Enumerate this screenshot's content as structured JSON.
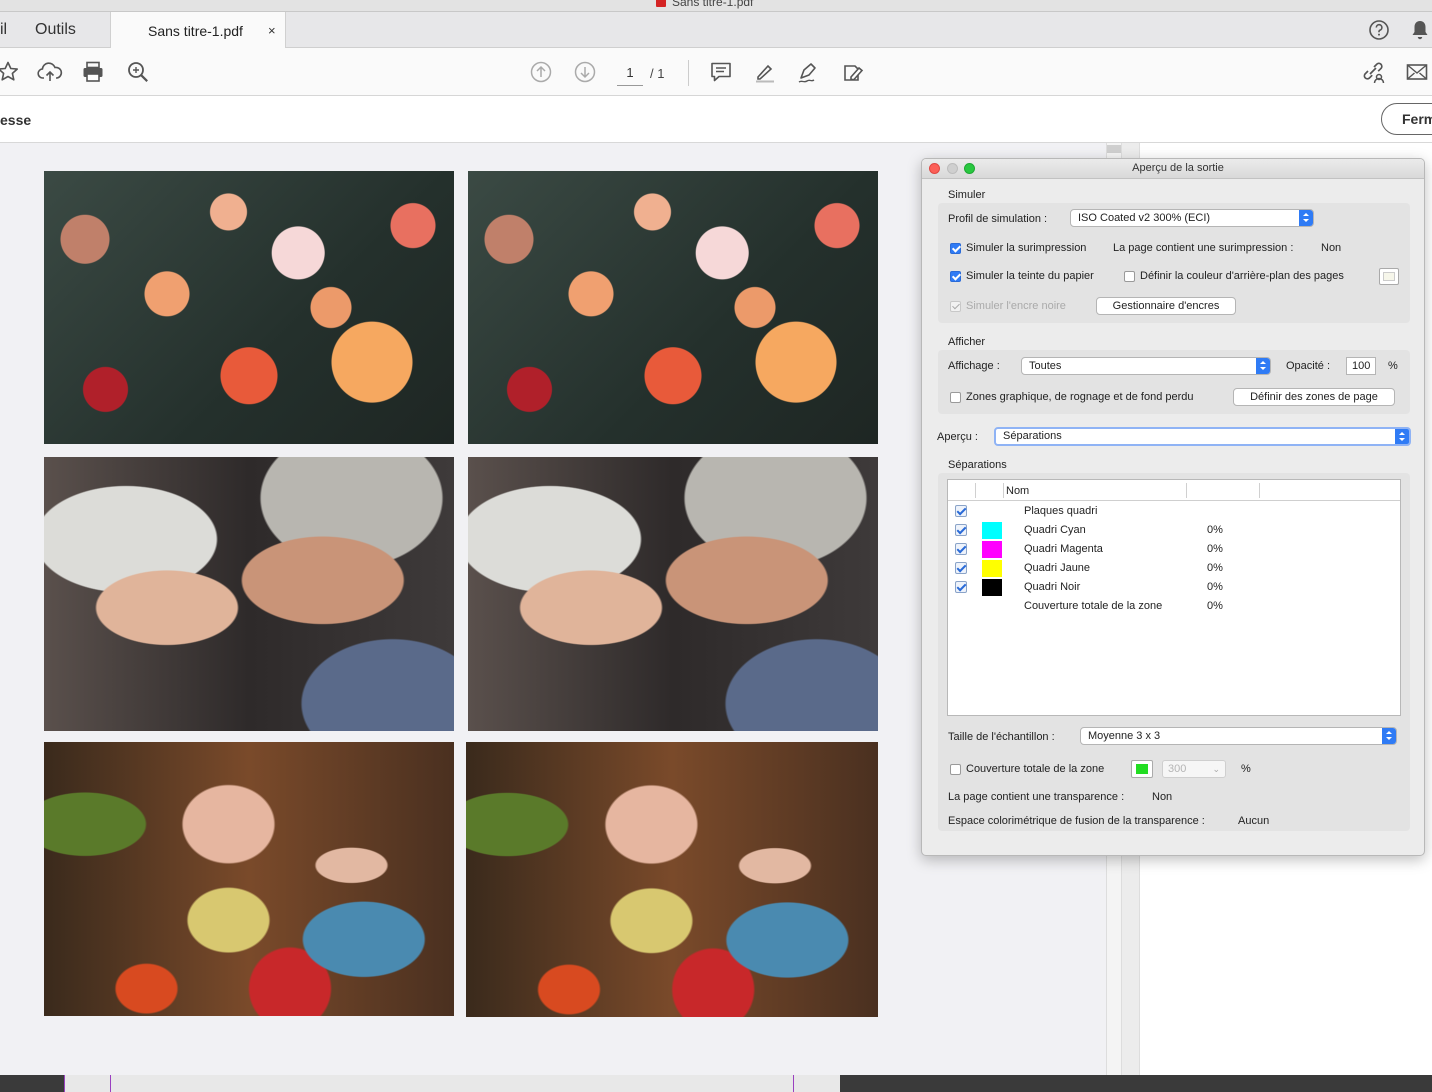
{
  "window": {
    "title": "Sans titre-1.pdf"
  },
  "tabs": {
    "partial": "il",
    "tools": "Outils",
    "document": "Sans titre-1.pdf",
    "close": "×"
  },
  "toolbar": {
    "page_current": "1",
    "page_total": "/ 1"
  },
  "secondary_bar": {
    "label": "esse",
    "close_label": "Ferm"
  },
  "dialog": {
    "title": "Aperçu de la sortie",
    "simulate": {
      "heading": "Simuler",
      "profile_label": "Profil de simulation :",
      "profile_value": "ISO Coated v2 300% (ECI)",
      "overprint_label": "Simuler la surimpression",
      "overprint_checked": true,
      "page_overprint_label": "La page contient une surimpression :",
      "page_overprint_value": "Non",
      "paper_label": "Simuler la teinte du papier",
      "paper_checked": true,
      "bg_label": "Définir la couleur d'arrière-plan des pages",
      "bg_checked": false,
      "black_ink_label": "Simuler l'encre noire",
      "ink_manager_label": "Gestionnaire d'encres"
    },
    "display": {
      "heading": "Afficher",
      "display_label": "Affichage :",
      "display_value": "Toutes",
      "opacity_label": "Opacité :",
      "opacity_value": "100",
      "percent": "%",
      "zones_label": "Zones graphique, de rognage et de fond perdu",
      "zones_checked": false,
      "define_zones_label": "Définir des zones de page"
    },
    "preview": {
      "label": "Aperçu :",
      "value": "Séparations"
    },
    "separations": {
      "heading": "Séparations",
      "col_name": "Nom",
      "rows": [
        {
          "name": "Plaques quadri",
          "percent": "",
          "color": "",
          "checked": true
        },
        {
          "name": "Quadri Cyan",
          "percent": "0%",
          "color": "#00ffff",
          "checked": true
        },
        {
          "name": "Quadri Magenta",
          "percent": "0%",
          "color": "#ff00ff",
          "checked": true
        },
        {
          "name": "Quadri Jaune",
          "percent": "0%",
          "color": "#ffff00",
          "checked": true
        },
        {
          "name": "Quadri Noir",
          "percent": "0%",
          "color": "#000000",
          "checked": true
        },
        {
          "name": "Couverture totale de la zone",
          "percent": "0%",
          "color": "",
          "checked": false
        }
      ]
    },
    "sample": {
      "label": "Taille de l'échantillon :",
      "value": "Moyenne 3 x 3"
    },
    "coverage": {
      "label": "Couverture totale de la zone",
      "checked": false,
      "value": "300",
      "percent": "%",
      "color": "#22dd22"
    },
    "transparency_label": "La page contient une transparence :",
    "transparency_value": "Non",
    "blend_label": "Espace colorimétrique de fusion de la transparence :",
    "blend_value": "Aucun"
  },
  "colors": {
    "accent": "#2f7bf5",
    "traffic_red": "#fc5f57",
    "traffic_gray": "#cfcfcf",
    "traffic_green": "#29c840"
  }
}
